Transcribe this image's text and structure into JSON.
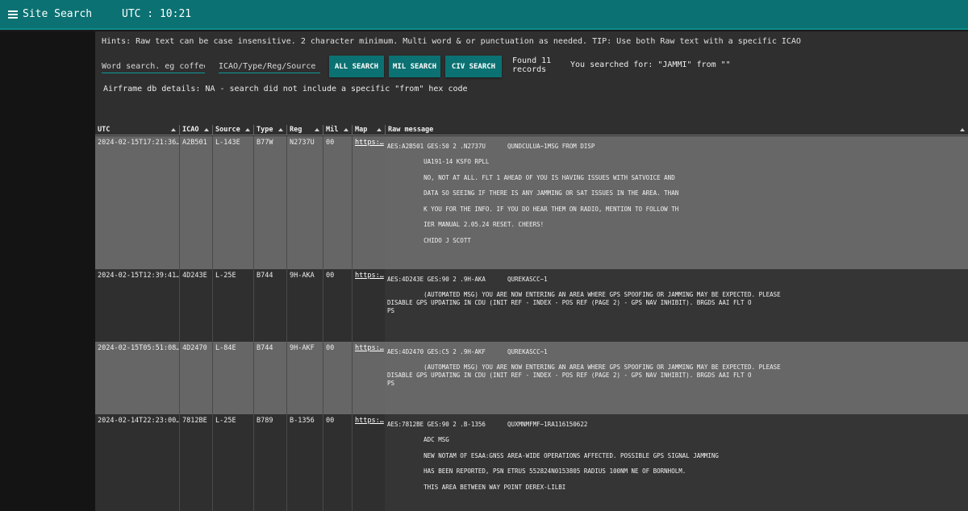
{
  "header": {
    "menu_icon": "hamburger-menu-icon",
    "title": "Site Search",
    "utc": "UTC : 10:21"
  },
  "search": {
    "hints": "Hints: Raw text can be case insensitive. 2 character minimum. Multi word & or punctuation as needed. TIP: Use both Raw text with a specific ICAO",
    "word_placeholder": "Word search. eg coffee",
    "icao_placeholder": "ICAO/Type/Reg/Source",
    "all_label": "ALL SEARCH",
    "mil_label": "MIL SEARCH",
    "civ_label": "CIV SEARCH",
    "found": "Found 11 records",
    "searched_for": "You searched for: \"JAMMI\" from \"\"",
    "airframe": "Airframe db details: NA - search did not include a specific \"from\" hex code"
  },
  "table": {
    "columns": [
      "UTC",
      "ICAO",
      "Source",
      "Type",
      "Reg",
      "Mil",
      "Map",
      "Raw message"
    ],
    "rows": [
      {
        "utc": "2024-02-15T17:21:36…",
        "icao": "A2B501",
        "source": "L-143E",
        "type": "B77W",
        "reg": "N2737U",
        "mil": "00",
        "map": "https:…",
        "raw": [
          "AES:A2B501 GES:50 2 .N2737U      QUNDCULUA~1MSG FROM DISP",
          "          UA191-14 KSFO RPLL",
          "          NO, NOT AT ALL. FLT 1 AHEAD OF YOU IS HAVING ISSUES WITH SATVOICE AND",
          "          DATA SO SEEING IF THERE IS ANY JAMMING OR SAT ISSUES IN THE AREA. THAN",
          "          K YOU FOR THE INFO. IF YOU DO HEAR THEM ON RADIO, MENTION TO FOLLOW TH",
          "          IER MANUAL 2.05.24 RESET. CHEERS!",
          "          CHIDO J SCOTT"
        ]
      },
      {
        "utc": "2024-02-15T12:39:41…",
        "icao": "4D243E",
        "source": "L-25E",
        "type": "B744",
        "reg": "9H-AKA",
        "mil": "00",
        "map": "https:…",
        "raw": [
          "AES:4D243E GES:90 2 .9H-AKA      QUREKASCC~1",
          "          (AUTOMATED MSG) YOU ARE NOW ENTERING AN AREA WHERE GPS SPOOFING OR JAMMING MAY BE EXPECTED. PLEASE",
          "DISABLE GPS UPDATING IN CDU (INIT REF - INDEX - POS REF (PAGE 2) - GPS NAV INHIBIT). BRGDS AAI FLT O",
          "PS"
        ]
      },
      {
        "utc": "2024-02-15T05:51:08…",
        "icao": "4D2470",
        "source": "L-84E",
        "type": "B744",
        "reg": "9H-AKF",
        "mil": "00",
        "map": "https:…",
        "raw": [
          "AES:4D2470 GES:C5 2 .9H-AKF      QUREKASCC~1",
          "          (AUTOMATED MSG) YOU ARE NOW ENTERING AN AREA WHERE GPS SPOOFING OR JAMMING MAY BE EXPECTED. PLEASE",
          "DISABLE GPS UPDATING IN CDU (INIT REF - INDEX - POS REF (PAGE 2) - GPS NAV INHIBIT). BRGDS AAI FLT O",
          "PS"
        ]
      },
      {
        "utc": "2024-02-14T22:23:00…",
        "icao": "7812BE",
        "source": "L-25E",
        "type": "B789",
        "reg": "B-1356",
        "mil": "00",
        "map": "https:…",
        "raw": [
          "AES:7812BE GES:90 2 .B-1356      QUXMNMFMF~1RA116150622",
          "          ADC MSG",
          "          NEW NOTAM OF ESAA:GNSS AREA-WIDE OPERATIONS AFFECTED. POSSIBLE GPS SIGNAL JAMMING",
          "          HAS BEEN REPORTED, PSN ETRUS 552824N0153805 RADIUS 100NM NE OF BORNHOLM.",
          "          THIS AREA BETWEEN WAY POINT DEREX-LILBI"
        ]
      }
    ]
  }
}
